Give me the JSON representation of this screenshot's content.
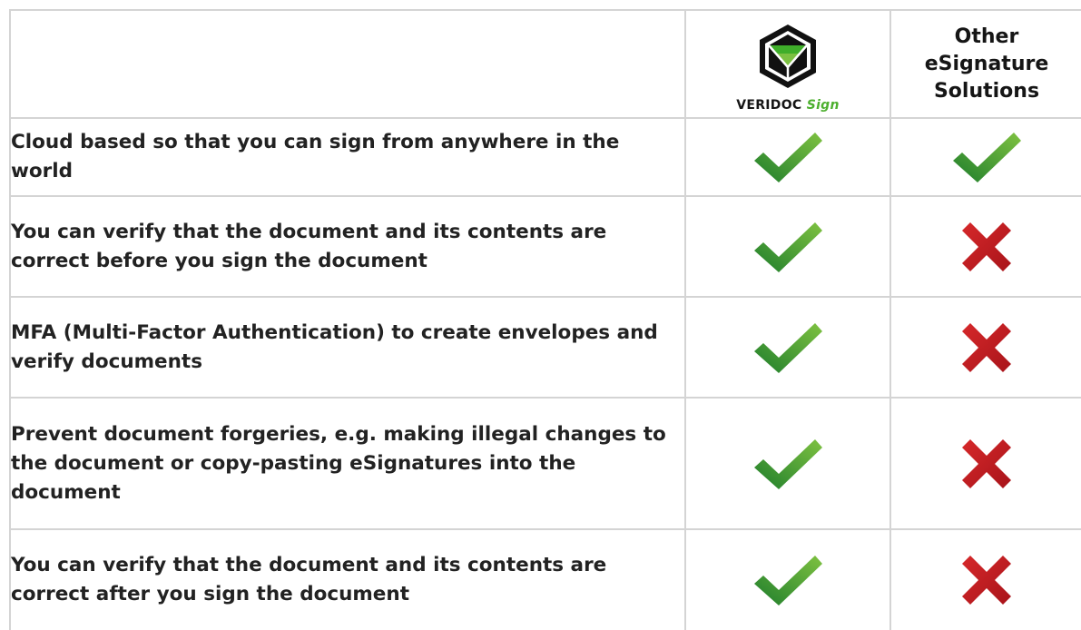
{
  "columns": {
    "veridoc": {
      "logo_icon": "veridoc-cube-logo",
      "brand_word1": "VERIDOC",
      "brand_word2": "Sign",
      "brand_accent_color": "#4caf2e"
    },
    "other": {
      "line1": "Other",
      "line2": "eSignature",
      "line3": "Solutions"
    }
  },
  "rows": [
    {
      "feature": "Cloud based so that you can sign from anywhere in the world",
      "veridoc": "check",
      "other": "check"
    },
    {
      "feature": "You can verify that the document and its contents are correct before you sign the document",
      "veridoc": "check",
      "other": "cross"
    },
    {
      "feature": "MFA (Multi-Factor Authentication) to create envelopes and verify documents",
      "veridoc": "check",
      "other": "cross"
    },
    {
      "feature": "Prevent document forgeries, e.g. making illegal changes to the document or copy-pasting eSignatures into the document",
      "veridoc": "check",
      "other": "cross"
    },
    {
      "feature": "You can verify that the document and its contents are correct after you sign the document",
      "veridoc": "check",
      "other": "cross"
    }
  ],
  "icons": {
    "check": "checkmark-icon",
    "cross": "cross-icon"
  },
  "colors": {
    "check_dark": "#1e7d2c",
    "check_light": "#7fc241",
    "cross": "#c8201f",
    "grid": "#d4d4d4"
  }
}
